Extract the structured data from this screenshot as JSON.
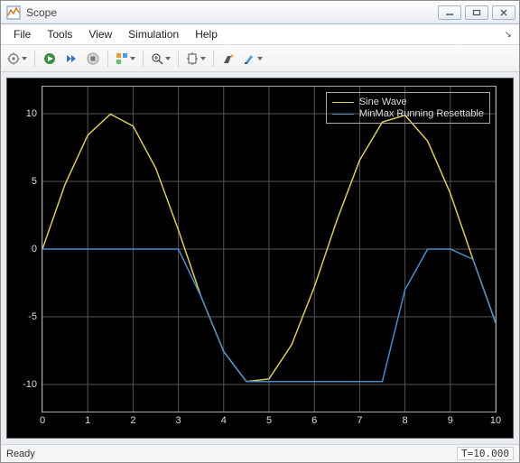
{
  "colors": {
    "series_sine": "#d9cc5a",
    "series_minmax": "#4b8cc8"
  },
  "window": {
    "title": "Scope"
  },
  "menu": {
    "items": [
      "File",
      "Tools",
      "View",
      "Simulation",
      "Help"
    ]
  },
  "status": {
    "ready": "Ready",
    "time": "T=10.000"
  },
  "legend": {
    "items": [
      {
        "label": "Sine Wave",
        "colorKey": "series_sine"
      },
      {
        "label": "MinMax Running Resettable",
        "colorKey": "series_minmax"
      }
    ]
  },
  "axes": {
    "xlim": [
      0,
      10
    ],
    "ylim": [
      -12,
      12
    ],
    "xticks": [
      0,
      1,
      2,
      3,
      4,
      5,
      6,
      7,
      8,
      9,
      10
    ],
    "yticks": [
      -10,
      -5,
      0,
      5,
      10
    ],
    "xtick_labels": [
      "0",
      "1",
      "2",
      "3",
      "4",
      "5",
      "6",
      "7",
      "8",
      "9",
      "10"
    ],
    "ytick_labels": [
      "-10",
      "-5",
      "0",
      "5",
      "10"
    ]
  },
  "chart_data": {
    "type": "line",
    "title": "",
    "xlabel": "",
    "ylabel": "",
    "xlim": [
      0,
      10
    ],
    "ylim": [
      -12,
      12
    ],
    "x": [
      0.0,
      0.5,
      1.0,
      1.5,
      2.0,
      2.5,
      3.0,
      3.5,
      4.0,
      4.5,
      5.0,
      5.5,
      6.0,
      6.5,
      7.0,
      7.5,
      8.0,
      8.5,
      9.0,
      9.5,
      10.0
    ],
    "series": [
      {
        "name": "Sine Wave",
        "values": [
          0.0,
          4.79,
          8.41,
          9.97,
          9.09,
          5.98,
          1.41,
          -3.51,
          -7.57,
          -9.78,
          -9.59,
          -7.06,
          -2.79,
          2.15,
          6.57,
          9.38,
          9.89,
          7.98,
          4.12,
          -0.75,
          -5.44
        ]
      },
      {
        "name": "MinMax Running Resettable",
        "values": [
          0.0,
          0.0,
          0.0,
          0.0,
          0.0,
          0.0,
          0.0,
          -3.51,
          -7.57,
          -9.78,
          -9.78,
          -9.78,
          -9.78,
          -9.78,
          -9.78,
          -9.78,
          -3.0,
          0.0,
          0.0,
          -0.75,
          -5.44
        ]
      }
    ],
    "legend_position": "upper right",
    "grid": true
  }
}
